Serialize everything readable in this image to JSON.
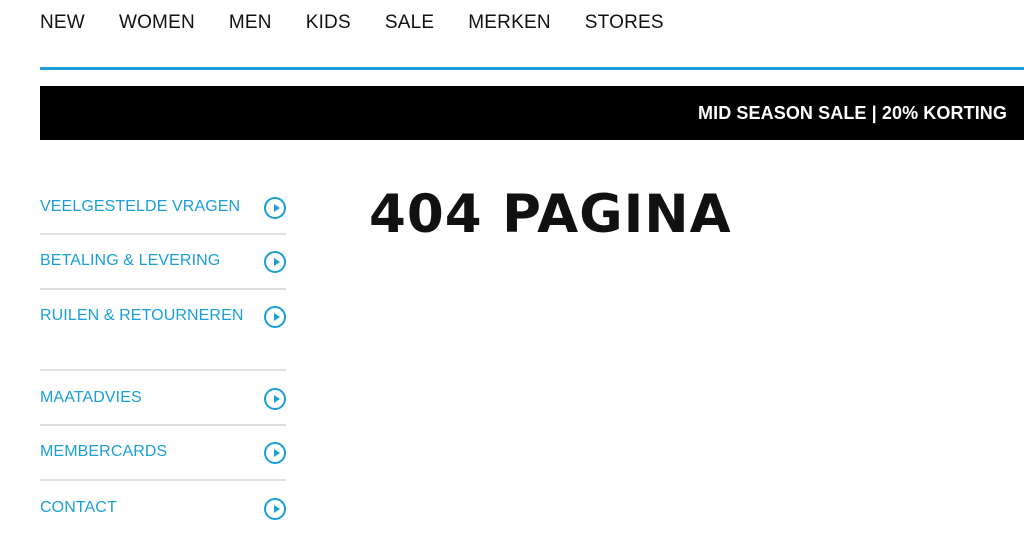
{
  "nav": {
    "items": [
      "NEW",
      "WOMEN",
      "MEN",
      "KIDS",
      "SALE",
      "MERKEN",
      "STORES"
    ]
  },
  "promo": {
    "text": "MID SEASON SALE | 20% KORTING"
  },
  "sidebar": {
    "items": [
      {
        "label": "VEELGESTELDE VRAGEN"
      },
      {
        "label": "BETALING & LEVERING"
      },
      {
        "label": "RUILEN & RETOURNEREN"
      },
      {
        "label": "MAATADVIES"
      },
      {
        "label": "MEMBERCARDS"
      },
      {
        "label": "CONTACT"
      }
    ],
    "accent_color": "#1a9fd8",
    "icon": "chevron-right-circle-icon"
  },
  "main": {
    "title": "404 PAGINA"
  }
}
